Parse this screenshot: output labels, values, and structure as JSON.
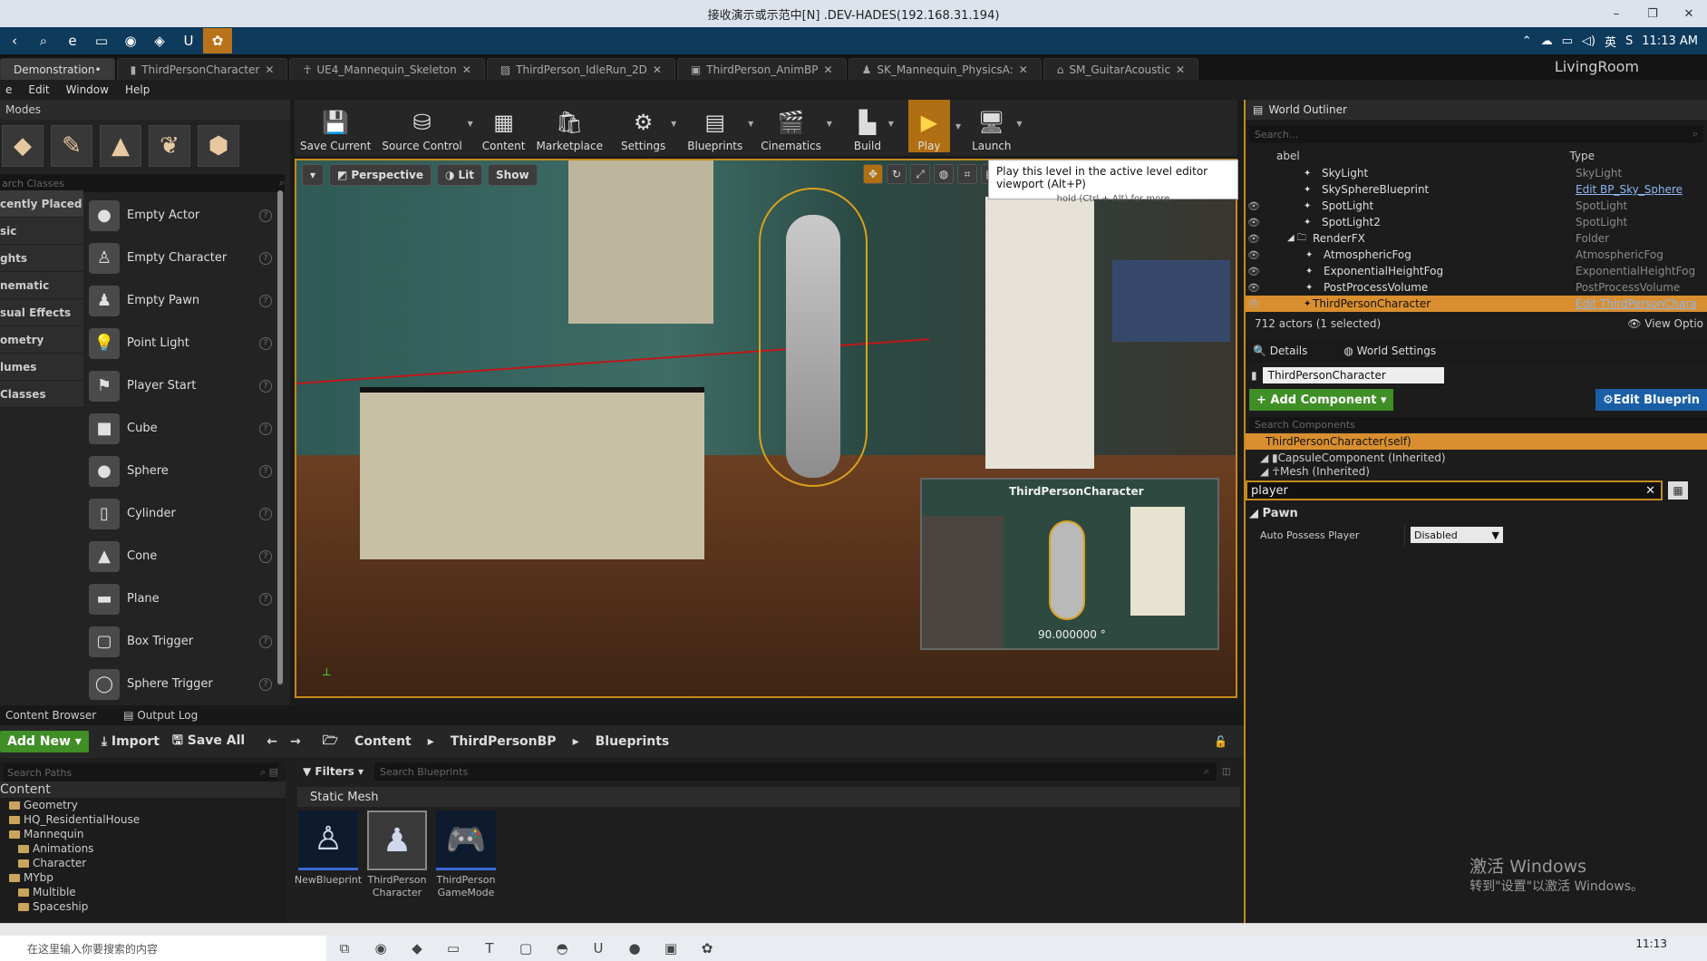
{
  "window": {
    "title": "接收演示或示范中[N] .DEV-HADES(192.168.31.194)",
    "controls": [
      "–",
      "❐",
      "✕"
    ]
  },
  "topbar": {
    "icons": [
      "‹",
      "⌕",
      "e",
      "▭",
      "◉",
      "◈",
      "U",
      "✿"
    ],
    "time": "11:13 AM",
    "ime": "英"
  },
  "tabs": [
    "Demonstration•",
    "ThirdPersonCharacter",
    "UE4_Mannequin_Skeleton",
    "ThirdPerson_IdleRun_2D",
    "ThirdPerson_AnimBP",
    "SK_Mannequin_PhysicsA:",
    "SM_GuitarAcoustic"
  ],
  "level_name": "LivingRoom",
  "menu": [
    "e",
    "Edit",
    "Window",
    "Help"
  ],
  "modes": {
    "tab": "Modes",
    "search_placeholder": "arch Classes",
    "categories": [
      "cently Placed",
      "sic",
      "ghts",
      "nematic",
      "sual Effects",
      "ometry",
      "lumes",
      "Classes"
    ],
    "actors": [
      "Empty Actor",
      "Empty Character",
      "Empty Pawn",
      "Point Light",
      "Player Start",
      "Cube",
      "Sphere",
      "Cylinder",
      "Cone",
      "Plane",
      "Box Trigger",
      "Sphere Trigger"
    ]
  },
  "toolbar": [
    "Save Current",
    "Source Control",
    "Content",
    "Marketplace",
    "Settings",
    "Blueprints",
    "Cinematics",
    "Build",
    "Play",
    "Launch"
  ],
  "viewport": {
    "perspective": "Perspective",
    "lit": "Lit",
    "show": "Show",
    "tooltip_main": "Play this level in the active level editor viewport (Alt+P)",
    "tooltip_sub": "hold (Ctrl + Alt) for more",
    "pip_title": "ThirdPersonCharacter",
    "pip_value": "90.000000 °"
  },
  "content_browser": {
    "tabs": [
      "Content Browser",
      "Output Log"
    ],
    "add_new": "Add New",
    "import": "Import",
    "save_all": "Save All",
    "breadcrumbs": [
      "Content",
      "ThirdPersonBP",
      "Blueprints"
    ],
    "search_paths": "Search Paths",
    "filters": "Filters",
    "search_blueprints": "Search Blueprints",
    "section": "Static Mesh",
    "tree": [
      {
        "label": "Content",
        "level": 0,
        "root": true
      },
      {
        "label": "Geometry",
        "level": 1
      },
      {
        "label": "HQ_ResidentialHouse",
        "level": 1
      },
      {
        "label": "Mannequin",
        "level": 1
      },
      {
        "label": "Animations",
        "level": 2
      },
      {
        "label": "Character",
        "level": 2
      },
      {
        "label": "MYbp",
        "level": 1
      },
      {
        "label": "Multible",
        "level": 2
      },
      {
        "label": "Spaceship",
        "level": 2
      }
    ],
    "assets": [
      {
        "label": "NewBlueprint"
      },
      {
        "label": "ThirdPerson Character"
      },
      {
        "label": "ThirdPerson GameMode"
      }
    ]
  },
  "outliner": {
    "tab": "World Outliner",
    "search_placeholder": "Search...",
    "col_label": "abel",
    "col_type": "Type",
    "rows": [
      {
        "name": "SkyLight",
        "type": "SkyLight"
      },
      {
        "name": "SkySphereBlueprint",
        "type": "Edit BP_Sky_Sphere"
      },
      {
        "name": "SpotLight",
        "type": "SpotLight"
      },
      {
        "name": "SpotLight2",
        "type": "SpotLight"
      },
      {
        "name": "RenderFX",
        "type": "Folder"
      },
      {
        "name": "AtmosphericFog",
        "type": "AtmosphericFog"
      },
      {
        "name": "ExponentialHeightFog",
        "type": "ExponentialHeightFog"
      },
      {
        "name": "PostProcessVolume",
        "type": "PostProcessVolume"
      },
      {
        "name": "ThirdPersonCharacter",
        "type": "Edit ThirdPersonChara"
      }
    ],
    "status": "712 actors (1 selected)",
    "view_options": "View Optio"
  },
  "details": {
    "tab_details": "Details",
    "tab_world": "World Settings",
    "actor_name": "ThirdPersonCharacter",
    "add_component": "+ Add Component",
    "edit_blueprint": "Edit Blueprin",
    "search_components": "Search Components",
    "self_row": "ThirdPersonCharacter(self)",
    "components": [
      "CapsuleComponent (Inherited)",
      "Mesh (Inherited)"
    ],
    "filter_value": "player",
    "category": "Pawn",
    "prop_key": "Auto Possess Player",
    "prop_value": "Disabled"
  },
  "watermark": {
    "line1": "激活 Windows",
    "line2": "转到\"设置\"以激活 Windows。"
  },
  "taskbar": {
    "search": "在这里输入你要搜索的内容",
    "time": "11:13"
  }
}
